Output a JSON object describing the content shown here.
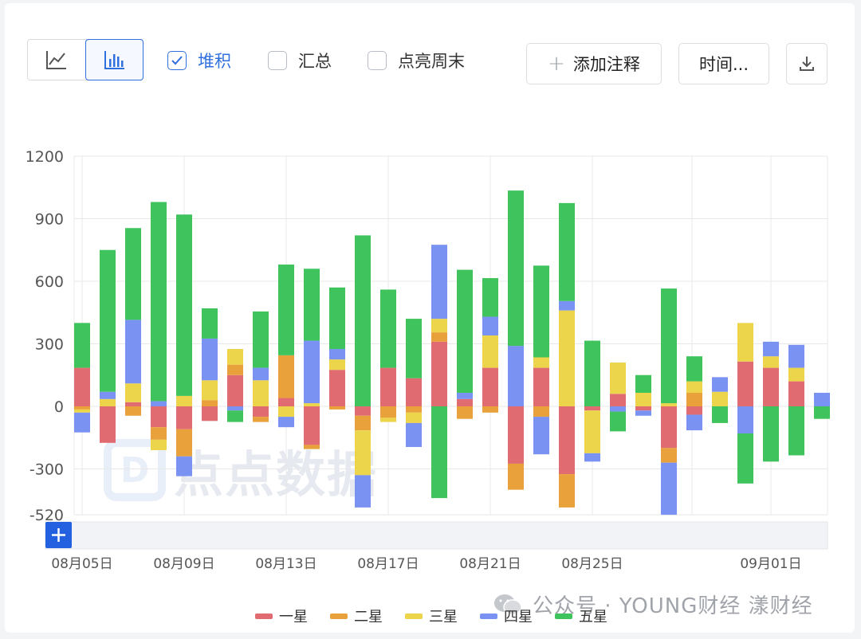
{
  "toolbar": {
    "line_view_icon": "line-chart-icon",
    "bar_view_icon": "bar-chart-icon",
    "stacked_label": "堆积",
    "stacked_checked": true,
    "summary_label": "汇总",
    "summary_checked": false,
    "weekend_label": "点亮周末",
    "weekend_checked": false,
    "add_note_label": "添加注释",
    "time_label": "时间...",
    "download_icon": "download-icon"
  },
  "watermark": {
    "text": "点点数据"
  },
  "credit": {
    "text": "公众号 · YOUNG财经 漾财经"
  },
  "zoom": {
    "expand_icon": "plus-icon"
  },
  "colors": {
    "一星": "#e06b70",
    "二星": "#e9a23b",
    "三星": "#ecd54a",
    "四星": "#7a93f2",
    "五星": "#3fc45d",
    "grid": "#e8e8e8",
    "accent": "#2f6fde"
  },
  "chart_data": {
    "type": "bar",
    "stacked": true,
    "ylim": [
      -520,
      1200
    ],
    "yticks": [
      -520,
      -300,
      0,
      300,
      600,
      900,
      1200
    ],
    "ytick_labels": [
      "-520",
      "-300",
      "0",
      "300",
      "600",
      "900",
      "1200"
    ],
    "xtick_labels": [
      {
        "index": 0,
        "label": "08月05日"
      },
      {
        "index": 4,
        "label": "08月09日"
      },
      {
        "index": 8,
        "label": "08月13日"
      },
      {
        "index": 12,
        "label": "08月17日"
      },
      {
        "index": 16,
        "label": "08月21日"
      },
      {
        "index": 20,
        "label": "08月25日"
      },
      {
        "index": 27,
        "label": "09月01日"
      }
    ],
    "legend": [
      "一星",
      "二星",
      "三星",
      "四星",
      "五星"
    ],
    "bars": [
      {
        "pos": {
          "一星": 185,
          "五星": 215
        },
        "neg": {
          "二星": -15,
          "三星": -15,
          "四星": -95
        }
      },
      {
        "pos": {
          "三星": 35,
          "四星": 35,
          "五星": 680
        },
        "neg": {
          "一星": -175
        }
      },
      {
        "pos": {
          "一星": 20,
          "三星": 90,
          "四星": 305,
          "五星": 440
        },
        "neg": {
          "二星": -45
        }
      },
      {
        "pos": {
          "四星": 25,
          "五星": 955
        },
        "neg": {
          "一星": -100,
          "二星": -60,
          "三星": -50
        }
      },
      {
        "pos": {
          "三星": 50,
          "五星": 870
        },
        "neg": {
          "一星": -110,
          "二星": -130,
          "四星": -95
        }
      },
      {
        "pos": {
          "二星": 30,
          "三星": 95,
          "四星": 200,
          "五星": 145
        },
        "neg": {
          "一星": -70
        }
      },
      {
        "pos": {
          "一星": 150,
          "二星": 50,
          "三星": 75
        },
        "neg": {
          "四星": -20,
          "五星": -55
        }
      },
      {
        "pos": {
          "三星": 125,
          "四星": 60,
          "五星": 270
        },
        "neg": {
          "一星": -50,
          "二星": -25
        }
      },
      {
        "pos": {
          "一星": 40,
          "二星": 205,
          "五星": 435
        },
        "neg": {
          "三星": -50,
          "四星": -50
        }
      },
      {
        "pos": {
          "三星": 15,
          "四星": 300,
          "五星": 345
        },
        "neg": {
          "一星": -185,
          "二星": -20
        }
      },
      {
        "pos": {
          "一星": 175,
          "三星": 50,
          "四星": 50,
          "五星": 295
        },
        "neg": {
          "二星": -15
        }
      },
      {
        "pos": {
          "五星": 820
        },
        "neg": {
          "一星": -45,
          "二星": -70,
          "三星": -215,
          "四星": -155
        }
      },
      {
        "pos": {
          "一星": 185,
          "五星": 375
        },
        "neg": {
          "二星": -55,
          "三星": -20
        }
      },
      {
        "pos": {
          "一星": 135,
          "五星": 285
        },
        "neg": {
          "二星": -30,
          "三星": -50,
          "四星": -115
        }
      },
      {
        "pos": {
          "一星": 310,
          "二星": 45,
          "三星": 65,
          "四星": 355
        },
        "neg": {
          "五星": -440
        }
      },
      {
        "pos": {
          "一星": 35,
          "四星": 30,
          "五星": 590
        },
        "neg": {
          "二星": -60
        }
      },
      {
        "pos": {
          "一星": 185,
          "三星": 155,
          "四星": 90,
          "五星": 185
        },
        "neg": {
          "二星": -30
        }
      },
      {
        "pos": {
          "四星": 290,
          "五星": 745
        },
        "neg": {
          "一星": -275,
          "二星": -125
        }
      },
      {
        "pos": {
          "一星": 185,
          "三星": 50,
          "五星": 440
        },
        "neg": {
          "二星": -50,
          "四星": -180
        }
      },
      {
        "pos": {
          "三星": 460,
          "四星": 45,
          "五星": 470
        },
        "neg": {
          "一星": -325,
          "二星": -160
        }
      },
      {
        "pos": {
          "五星": 315
        },
        "neg": {
          "一星": -20,
          "三星": -205,
          "四星": -40
        }
      },
      {
        "pos": {
          "一星": 60,
          "三星": 150
        },
        "neg": {
          "四星": -25,
          "五星": -95
        }
      },
      {
        "pos": {
          "三星": 65,
          "五星": 85
        },
        "neg": {
          "一星": -20,
          "四星": -25
        }
      },
      {
        "pos": {
          "三星": 15,
          "五星": 550
        },
        "neg": {
          "一星": -200,
          "二星": -70,
          "四星": -250
        }
      },
      {
        "pos": {
          "二星": 65,
          "三星": 55,
          "五星": 120
        },
        "neg": {
          "一星": -40,
          "四星": -75
        }
      },
      {
        "pos": {
          "三星": 70,
          "四星": 70
        },
        "neg": {
          "五星": -80
        }
      },
      {
        "pos": {
          "一星": 215,
          "三星": 185
        },
        "neg": {
          "四星": -130,
          "五星": -240
        }
      },
      {
        "pos": {
          "一星": 185,
          "三星": 55,
          "四星": 70
        },
        "neg": {
          "五星": -265
        }
      },
      {
        "pos": {
          "一星": 120,
          "三星": 65,
          "四星": 110
        },
        "neg": {
          "五星": -235
        }
      },
      {
        "pos": {
          "四星": 65
        },
        "neg": {
          "五星": -60
        }
      }
    ]
  }
}
